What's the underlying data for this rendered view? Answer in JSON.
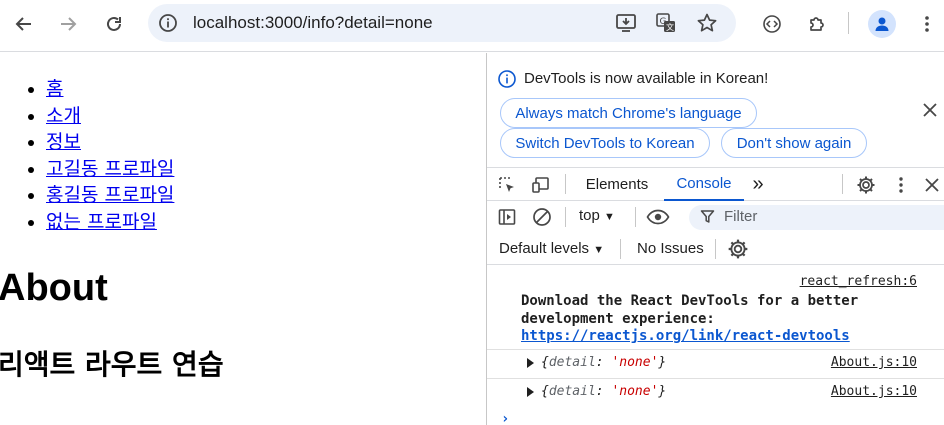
{
  "browser": {
    "url": "localhost:3000/info?detail=none"
  },
  "page": {
    "nav_items": [
      "홈",
      "소개",
      "정보",
      "고길동 프로파일",
      "홍길동 프로파일",
      "없는 프로파일"
    ],
    "title": "About",
    "subtitle": "리액트 라우트 연습"
  },
  "devtools": {
    "banner": {
      "message": "DevTools is now available in Korean!",
      "btn_match": "Always match Chrome's language",
      "btn_switch": "Switch DevTools to Korean",
      "btn_dont_show": "Don't show again"
    },
    "tabs": {
      "elements": "Elements",
      "console": "Console",
      "more": "»"
    },
    "filterbar": {
      "context": "top",
      "filter_placeholder": "Filter"
    },
    "levels": {
      "default_levels": "Default levels",
      "issues": "No Issues"
    },
    "console": {
      "msg1_source": "react_refresh:6",
      "msg1_text": "Download the React DevTools for a better development experience:",
      "msg1_link": "https://reactjs.org/link/react-devtools",
      "log1": {
        "open": "{",
        "key": "detail",
        "colon": ": ",
        "value": "'none'",
        "close": "}",
        "source": "About.js:10"
      },
      "log2": {
        "open": "{",
        "key": "detail",
        "colon": ": ",
        "value": "'none'",
        "close": "}",
        "source": "About.js:10"
      },
      "prompt": "›"
    }
  },
  "colors": {
    "accent": "#0b57d0",
    "link": "#0000ee",
    "string_value": "#c80000",
    "omnibox_bg": "#edf2fa"
  }
}
